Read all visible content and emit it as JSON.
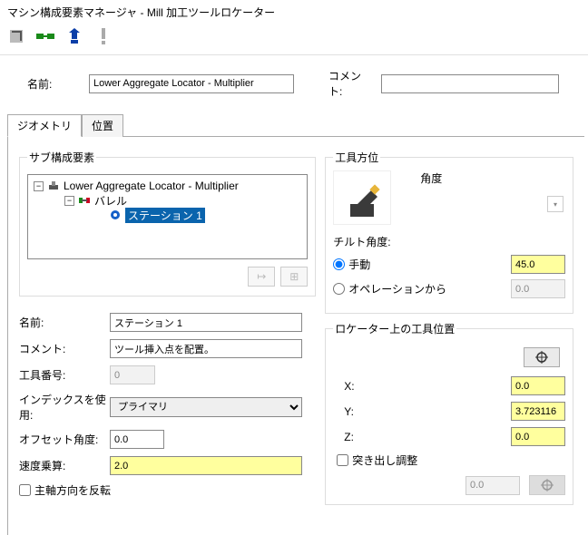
{
  "window": {
    "title": "マシン構成要素マネージャ - Mill 加工ツールロケーター"
  },
  "top": {
    "name_label": "名前:",
    "name_value": "Lower Aggregate Locator - Multiplier",
    "comment_label": "コメント:",
    "comment_value": ""
  },
  "tabs": {
    "geometry": "ジオメトリ",
    "position": "位置"
  },
  "tree": {
    "legend": "サブ構成要素",
    "root": "Lower Aggregate Locator - Multiplier",
    "barrel": "バレル",
    "station": "ステーション 1",
    "btn1": "↦",
    "btn2": "⊞"
  },
  "form": {
    "name_label": "名前:",
    "name_value": "ステーション 1",
    "comment_label": "コメント:",
    "comment_value": "ツール挿入点を配置。",
    "toolno_label": "工具番号:",
    "toolno_value": "0",
    "index_label": "インデックスを使用:",
    "index_value": "プライマリ",
    "offset_label": "オフセット角度:",
    "offset_value": "0.0",
    "speedmul_label": "速度乗算:",
    "speedmul_value": "2.0",
    "reverse_label": "主軸方向を反転"
  },
  "orient": {
    "legend": "工具方位",
    "angle_label": "角度",
    "tilt_label": "チルト角度:",
    "manual_label": "手動",
    "manual_value": "45.0",
    "op_label": "オペレーションから",
    "op_value": "0.0"
  },
  "locpos": {
    "legend": "ロケーター上の工具位置",
    "x_label": "X:",
    "x_value": "0.0",
    "y_label": "Y:",
    "y_value": "3.723116",
    "z_label": "Z:",
    "z_value": "0.0",
    "prot_label": "突き出し調整",
    "prot_value": "0.0"
  }
}
